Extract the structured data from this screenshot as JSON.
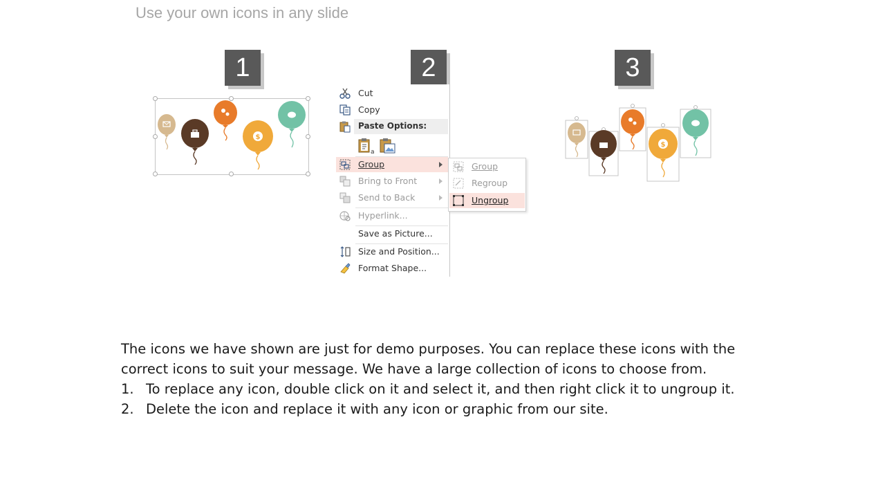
{
  "slide": {
    "title": "Use your own icons in any slide"
  },
  "steps": [
    {
      "number": "1"
    },
    {
      "number": "2"
    },
    {
      "number": "3"
    }
  ],
  "balloon_colors": {
    "beige": "#d6b98f",
    "brown": "#5a3a26",
    "orange": "#e87b2a",
    "yellow": "#f0a93a",
    "teal": "#72c2a6"
  },
  "context_menu": {
    "cut": "Cut",
    "copy": "Copy",
    "paste_options": "Paste Options:",
    "group": "Group",
    "bring_to_front": "Bring to Front",
    "send_to_back": "Send to Back",
    "hyperlink": "Hyperlink...",
    "save_as_picture": "Save as Picture...",
    "size_and_position": "Size and Position...",
    "format_shape": "Format Shape..."
  },
  "group_submenu": {
    "group": "Group",
    "regroup": "Regroup",
    "ungroup": "Ungroup"
  },
  "body": {
    "intro": "The icons we have shown are just for demo purposes. You can replace these icons with the correct icons to suit your message. We have a large collection of icons to choose from.",
    "steps": [
      {
        "num": "1.",
        "text": "To replace any icon, double click on it and select it, and then right click it to ungroup it."
      },
      {
        "num": "2.",
        "text": "Delete the icon and replace it with any icon or graphic from our site."
      }
    ]
  }
}
